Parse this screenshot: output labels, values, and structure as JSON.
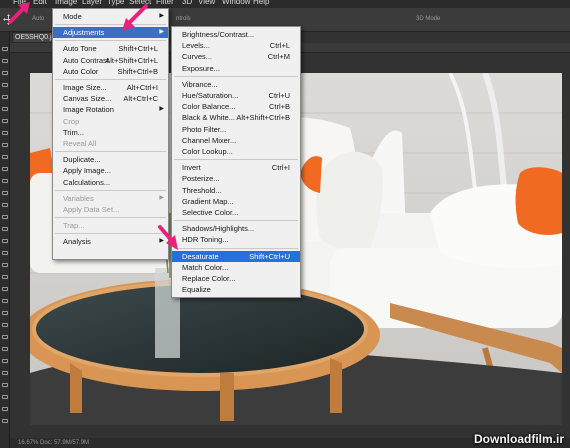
{
  "menubar": [
    "File",
    "Edit",
    "Image",
    "Layer",
    "Type",
    "Select",
    "Filter",
    "3D",
    "View",
    "Window",
    "Help"
  ],
  "optbar": {
    "auto_text": "Auto",
    "controls_text": "ntrols",
    "mode_3d": "3D Mode"
  },
  "document_tab": "OE5SHQ0.jp",
  "status": "16.67%   Doc: 57.9M/57.9M",
  "watermark": "Downloadfilm.ir",
  "image_menu": [
    {
      "label": "Mode",
      "shortcut": "",
      "arrow": true,
      "state": ""
    },
    {
      "sep": true
    },
    {
      "label": "Adjustments",
      "shortcut": "",
      "arrow": true,
      "state": "hl"
    },
    {
      "sep": true
    },
    {
      "label": "Auto Tone",
      "shortcut": "Shift+Ctrl+L",
      "state": ""
    },
    {
      "label": "Auto Contrast",
      "shortcut": "Alt+Shift+Ctrl+L",
      "state": ""
    },
    {
      "label": "Auto Color",
      "shortcut": "Shift+Ctrl+B",
      "state": ""
    },
    {
      "sep": true
    },
    {
      "label": "Image Size...",
      "shortcut": "Alt+Ctrl+I",
      "state": ""
    },
    {
      "label": "Canvas Size...",
      "shortcut": "Alt+Ctrl+C",
      "state": ""
    },
    {
      "label": "Image Rotation",
      "shortcut": "",
      "arrow": true,
      "state": ""
    },
    {
      "label": "Crop",
      "shortcut": "",
      "state": "disabled"
    },
    {
      "label": "Trim...",
      "shortcut": "",
      "state": ""
    },
    {
      "label": "Reveal All",
      "shortcut": "",
      "state": "disabled"
    },
    {
      "sep": true
    },
    {
      "label": "Duplicate...",
      "shortcut": "",
      "state": ""
    },
    {
      "label": "Apply Image...",
      "shortcut": "",
      "state": ""
    },
    {
      "label": "Calculations...",
      "shortcut": "",
      "state": ""
    },
    {
      "sep": true
    },
    {
      "label": "Variables",
      "shortcut": "",
      "arrow": true,
      "state": "disabled"
    },
    {
      "label": "Apply Data Set...",
      "shortcut": "",
      "state": "disabled"
    },
    {
      "sep": true
    },
    {
      "label": "Trap...",
      "shortcut": "",
      "state": "disabled"
    },
    {
      "sep": true
    },
    {
      "label": "Analysis",
      "shortcut": "",
      "arrow": true,
      "state": ""
    }
  ],
  "adjustments_menu": [
    {
      "label": "Brightness/Contrast...",
      "shortcut": "",
      "state": ""
    },
    {
      "label": "Levels...",
      "shortcut": "Ctrl+L",
      "state": ""
    },
    {
      "label": "Curves...",
      "shortcut": "Ctrl+M",
      "state": ""
    },
    {
      "label": "Exposure...",
      "shortcut": "",
      "state": ""
    },
    {
      "sep": true
    },
    {
      "label": "Vibrance...",
      "shortcut": "",
      "state": ""
    },
    {
      "label": "Hue/Saturation...",
      "shortcut": "Ctrl+U",
      "state": ""
    },
    {
      "label": "Color Balance...",
      "shortcut": "Ctrl+B",
      "state": ""
    },
    {
      "label": "Black & White...",
      "shortcut": "Alt+Shift+Ctrl+B",
      "state": ""
    },
    {
      "label": "Photo Filter...",
      "shortcut": "",
      "state": ""
    },
    {
      "label": "Channel Mixer...",
      "shortcut": "",
      "state": ""
    },
    {
      "label": "Color Lookup...",
      "shortcut": "",
      "state": ""
    },
    {
      "sep": true
    },
    {
      "label": "Invert",
      "shortcut": "Ctrl+I",
      "state": ""
    },
    {
      "label": "Posterize...",
      "shortcut": "",
      "state": ""
    },
    {
      "label": "Threshold...",
      "shortcut": "",
      "state": ""
    },
    {
      "label": "Gradient Map...",
      "shortcut": "",
      "state": ""
    },
    {
      "label": "Selective Color...",
      "shortcut": "",
      "state": ""
    },
    {
      "sep": true
    },
    {
      "label": "Shadows/Highlights...",
      "shortcut": "",
      "state": ""
    },
    {
      "label": "HDR Toning...",
      "shortcut": "",
      "state": ""
    },
    {
      "sep": true
    },
    {
      "label": "Desaturate",
      "shortcut": "Shift+Ctrl+U",
      "state": "selected"
    },
    {
      "label": "Match Color...",
      "shortcut": "",
      "state": ""
    },
    {
      "label": "Replace Color...",
      "shortcut": "",
      "state": ""
    },
    {
      "label": "Equalize",
      "shortcut": "",
      "state": ""
    }
  ],
  "colors": {
    "accent_arrow": "#e8217a",
    "highlight": "#3b6fc4",
    "selected": "#2670d9",
    "pillow": "#f06a22"
  }
}
